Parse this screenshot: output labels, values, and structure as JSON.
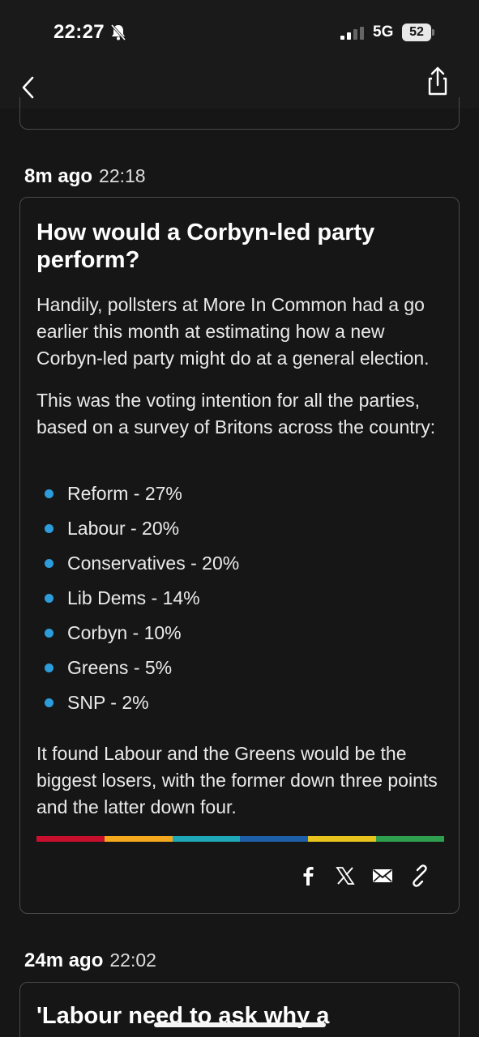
{
  "status_bar": {
    "time": "22:27",
    "network": "5G",
    "battery": "52"
  },
  "posts": [
    {
      "ago": "8m ago",
      "time": "22:18",
      "headline": "How would a Corbyn-led party perform?",
      "paragraphs": [
        "Handily, pollsters at More In Common had a go earlier this month at estimating how a new Corbyn-led party might do at a general election.",
        "This was the voting intention for all the parties, based on a survey of Britons across the country:",
        "It found Labour and the Greens would be the biggest losers, with the former down three points and the latter down four."
      ],
      "bullets": [
        "Reform - 27%",
        "Labour - 20%",
        "Conservatives - 20%",
        "Lib Dems - 14%",
        "Corbyn - 10%",
        "Greens - 5%",
        "SNP - 2%"
      ],
      "stripe_colors": [
        "#c8102e",
        "#f4a81d",
        "#1fa8b8",
        "#1d5fa8",
        "#e8c41d",
        "#2e9e4f"
      ],
      "share_icons": [
        "facebook-icon",
        "x-icon",
        "email-icon",
        "link-icon"
      ]
    },
    {
      "ago": "24m ago",
      "time": "22:02",
      "headline": "'Labour need to ask why a"
    }
  ],
  "colors": {
    "bullet": "#2d9cdb",
    "background": "#161616",
    "card_border": "#4a4a4a"
  }
}
